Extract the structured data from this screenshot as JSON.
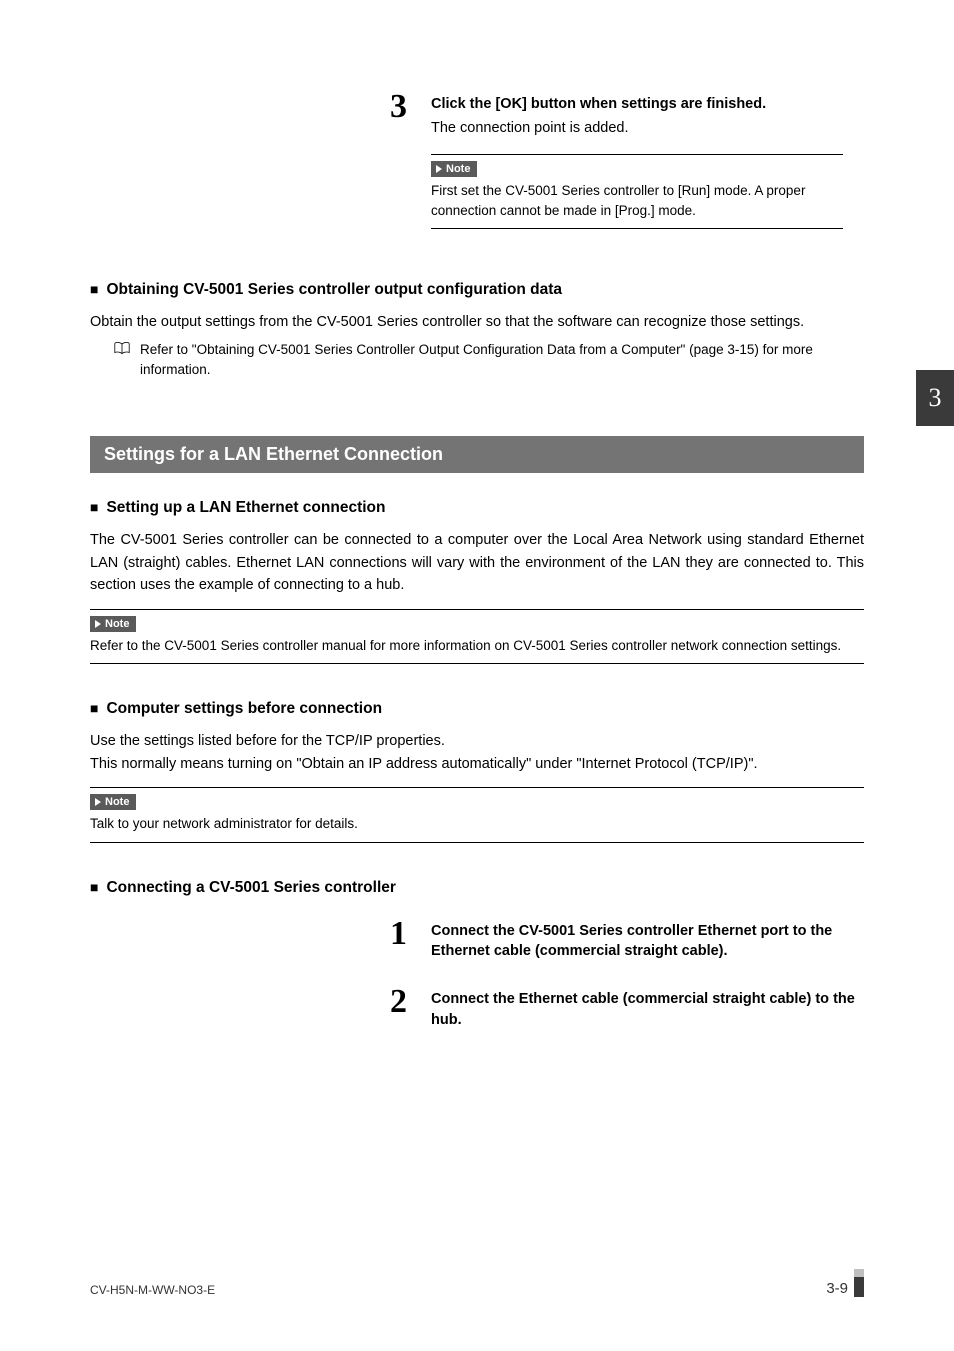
{
  "step3": {
    "num": "3",
    "title": "Click the [OK] button when settings are finished.",
    "text": "The connection point is added.",
    "note_label": "Note",
    "note_text": "First set the CV-5001 Series controller to [Run] mode. A proper connection cannot be made in [Prog.] mode."
  },
  "sub1": {
    "title": "Obtaining CV-5001 Series controller output configuration data",
    "body": "Obtain the output settings from the CV-5001 Series controller so that the software can recognize those settings.",
    "ref": "Refer to \"Obtaining CV-5001 Series Controller Output Configuration Data from a Computer\" (page 3-15) for more information."
  },
  "section_bar": "Settings for a LAN Ethernet Connection",
  "sub2": {
    "title": "Setting up a LAN Ethernet connection",
    "body": "The CV-5001 Series controller can be connected to a computer over the Local Area Network using standard Ethernet LAN (straight) cables. Ethernet LAN connections will vary with the environment of the LAN they are connected to. This section uses the example of connecting to a hub.",
    "note_label": "Note",
    "note_text": "Refer to the CV-5001 Series controller manual for more information on CV-5001 Series controller network connection settings."
  },
  "sub3": {
    "title": "Computer settings before connection",
    "line1": "Use the settings listed before for the TCP/IP properties.",
    "line2": "This normally means turning on \"Obtain an IP address automatically\" under \"Internet Protocol (TCP/IP)\".",
    "note_label": "Note",
    "note_text": "Talk to your network administrator for details."
  },
  "sub4": {
    "title": "Connecting a CV-5001 Series controller"
  },
  "step1": {
    "num": "1",
    "title": "Connect the CV-5001 Series controller Ethernet port to the Ethernet cable (commercial straight cable)."
  },
  "step2": {
    "num": "2",
    "title": "Connect the Ethernet cable (commercial straight cable) to the hub."
  },
  "side_tab": "3",
  "footer": {
    "doc_id": "CV-H5N-M-WW-NO3-E",
    "page": "3-9"
  }
}
